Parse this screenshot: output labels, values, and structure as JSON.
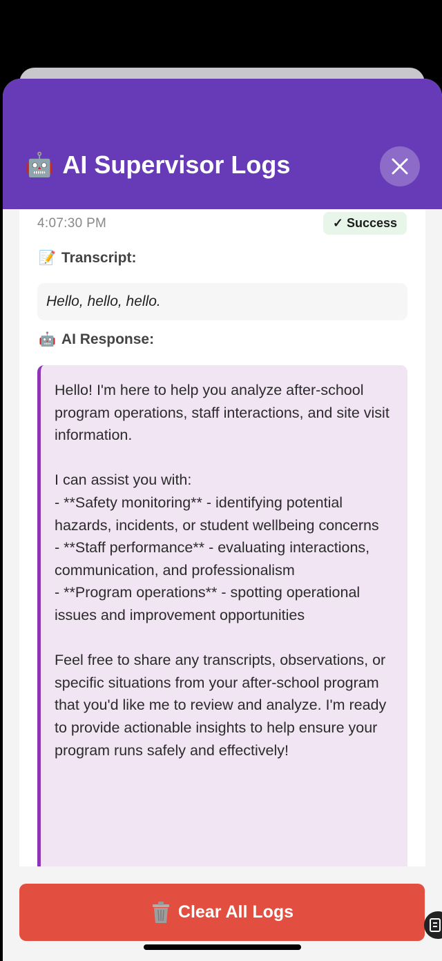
{
  "header": {
    "icon": "robot-icon",
    "title": "AI Supervisor Logs",
    "close_icon": "close-icon",
    "accent_color": "#673ab7"
  },
  "log_entry": {
    "timestamp": "4:07:30 PM",
    "status": "✓ Success",
    "transcript_label": "Transcript:",
    "transcript_icon": "memo-icon",
    "transcript_text": "Hello, hello, hello.",
    "response_label": "AI Response:",
    "response_icon": "robot-icon",
    "response_text": "Hello! I'm here to help you analyze after-school program operations, staff interactions, and site visit information.\n\nI can assist you with:\n- **Safety monitoring** - identifying potential hazards, incidents, or student wellbeing concerns\n- **Staff performance** - evaluating interactions, communication, and professionalism\n- **Program operations** - spotting operational issues and improvement opportunities\n\nFeel free to share any transcripts, observations, or specific situations from your after-school program that you'd like me to review and analyze. I'm ready to provide actionable insights to help ensure your program runs safely and effectively!"
  },
  "footer": {
    "clear_label": "Clear All Logs",
    "clear_icon": "trash-icon",
    "button_color": "#e24e3f"
  }
}
